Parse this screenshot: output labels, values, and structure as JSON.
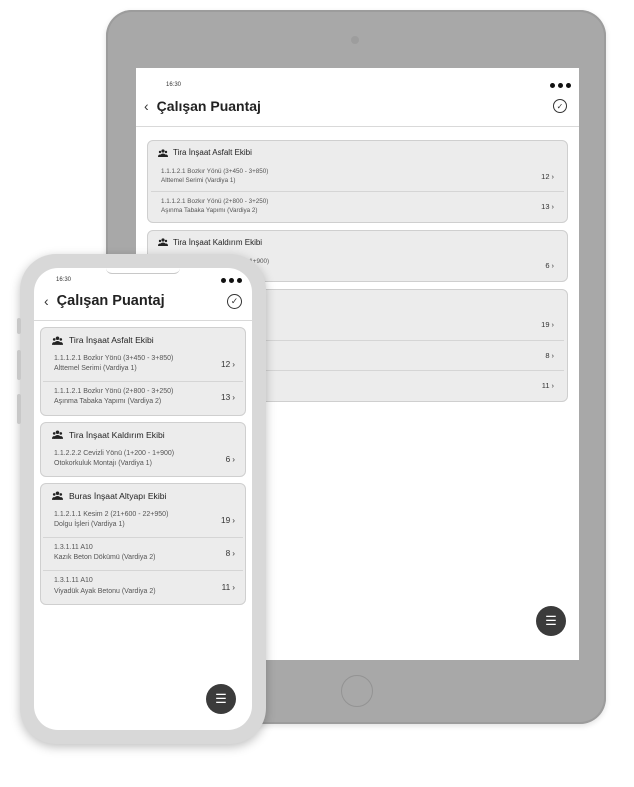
{
  "app": {
    "time": "16:30",
    "title": "Çalışan Puantaj",
    "back_icon": "‹",
    "check_icon": "✓",
    "fab_icon": "☰"
  },
  "groups": [
    {
      "name": "Tira İnşaat Asfalt Ekibi",
      "rows": [
        {
          "line1": "1.1.1.2.1 Bozkır Yönü (3+450 - 3+850)",
          "line2": "Alttemel Serimi (Vardiya 1)",
          "count": "12"
        },
        {
          "line1": "1.1.1.2.1 Bozkır Yönü (2+800 - 3+250)",
          "line2": "Aşınma Tabaka Yapımı (Vardiya 2)",
          "count": "13"
        }
      ]
    },
    {
      "name": "Tira İnşaat Kaldırım Ekibi",
      "rows": [
        {
          "line1": "1.1.2.2.2 Cevizli Yönü (1+200 - 1+900)",
          "line2": "Otokorkuluk Montajı (Vardiya 1)",
          "count": "6"
        }
      ]
    },
    {
      "name": "Buras İnşaat Altyapı Ekibi",
      "rows": [
        {
          "line1": "1.1.2.1.1 Kesim 2 (21+600 - 22+950)",
          "line2": "Dolgu İşleri (Vardiya 1)",
          "count": "19"
        },
        {
          "line1": "1.3.1.11 A10",
          "line2": "Kazık Beton Dökümü (Vardiya 2)",
          "count": "8"
        },
        {
          "line1": "1.3.1.11 A10",
          "line2": "Viyadük Ayak Betonu (Vardiya 2)",
          "count": "11"
        }
      ]
    }
  ]
}
